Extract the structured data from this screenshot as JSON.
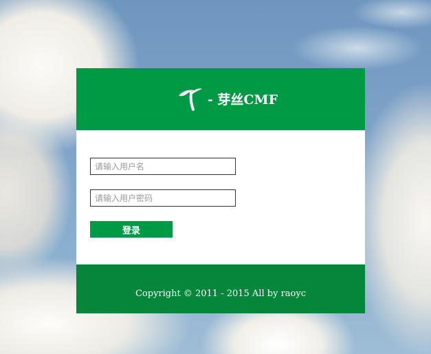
{
  "header": {
    "logo_icon": "sprout-icon",
    "title": "- 芽丝CMF"
  },
  "form": {
    "username": {
      "value": "",
      "placeholder": "请输入用户名"
    },
    "password": {
      "value": "",
      "placeholder": "请输入用户密码"
    },
    "submit_label": "登录"
  },
  "footer": {
    "copyright": "Copyright © 2011 - 2015 All by raoyc"
  },
  "colors": {
    "brand_green": "#009944",
    "footer_green": "#04873a",
    "field_border": "#333333",
    "placeholder": "#9a9a9a"
  }
}
